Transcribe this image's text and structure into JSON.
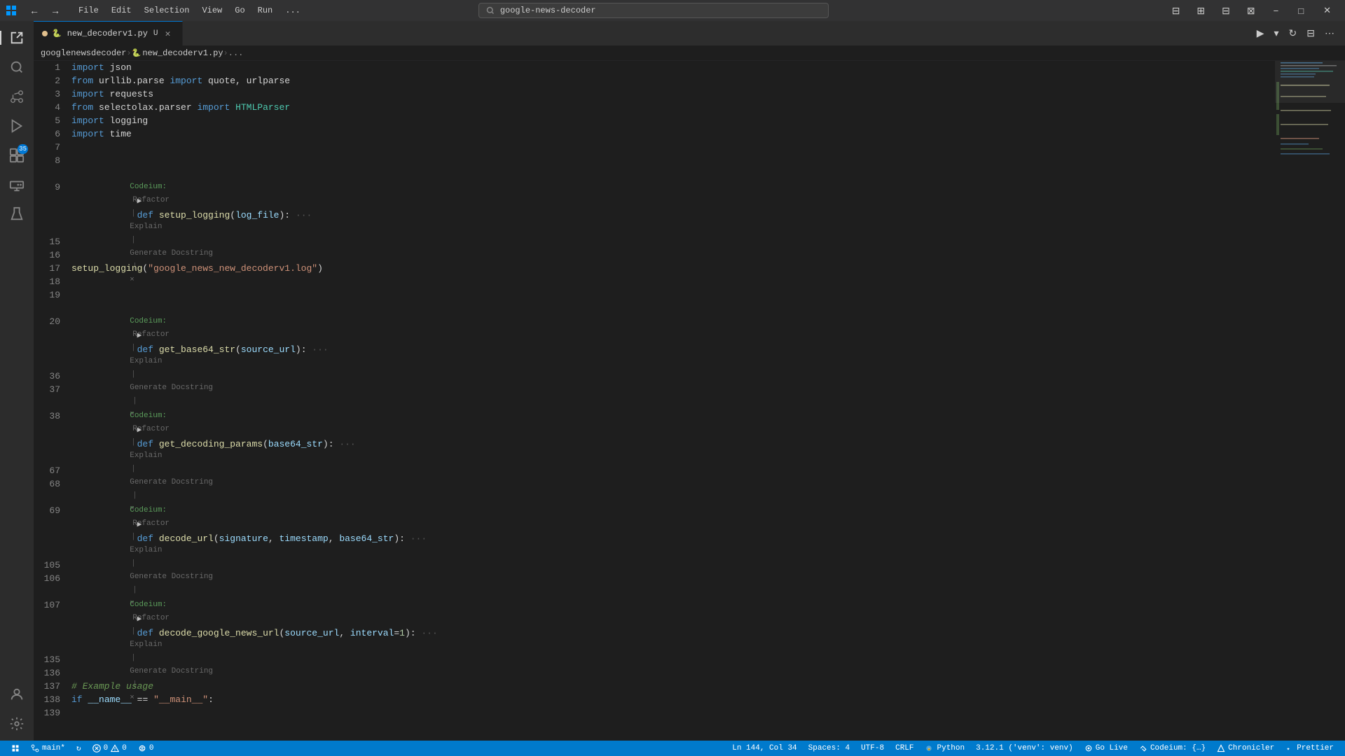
{
  "titlebar": {
    "icon": "⊞",
    "menus": [
      "File",
      "Edit",
      "Selection",
      "View",
      "Go",
      "Run",
      "..."
    ],
    "search_placeholder": "google-news-decoder",
    "nav_back": "←",
    "nav_forward": "→",
    "controls": [
      "⧉",
      "−",
      "□",
      "✕"
    ]
  },
  "activity_bar": {
    "items": [
      {
        "name": "explorer",
        "icon": "⬜",
        "label": "Explorer"
      },
      {
        "name": "search",
        "icon": "🔍",
        "label": "Search"
      },
      {
        "name": "source-control",
        "icon": "⑂",
        "label": "Source Control"
      },
      {
        "name": "run-debug",
        "icon": "▷",
        "label": "Run and Debug"
      },
      {
        "name": "extensions",
        "icon": "⊞",
        "label": "Extensions",
        "badge": "35"
      },
      {
        "name": "remote-explorer",
        "icon": "◫",
        "label": "Remote Explorer"
      },
      {
        "name": "testing",
        "icon": "⚗",
        "label": "Testing"
      }
    ],
    "bottom_items": [
      {
        "name": "account",
        "icon": "👤",
        "label": "Account"
      },
      {
        "name": "settings",
        "icon": "⚙",
        "label": "Settings"
      }
    ]
  },
  "tabs": [
    {
      "name": "new_decoderv1.py",
      "dirty": true,
      "active": true
    }
  ],
  "breadcrumb": {
    "parts": [
      "googlenewsdecoder",
      "new_decoderv1.py",
      "..."
    ]
  },
  "editor": {
    "lines": [
      {
        "ln": "1",
        "type": "code",
        "content": "import json"
      },
      {
        "ln": "2",
        "type": "code",
        "content": "from urllib.parse import quote, urlparse"
      },
      {
        "ln": "3",
        "type": "code",
        "content": "import requests"
      },
      {
        "ln": "4",
        "type": "code",
        "content": "from selectolax.parser import HTMLParser"
      },
      {
        "ln": "5",
        "type": "code",
        "content": "import logging"
      },
      {
        "ln": "6",
        "type": "code",
        "content": "import time"
      },
      {
        "ln": "7",
        "type": "blank"
      },
      {
        "ln": "8",
        "type": "blank"
      },
      {
        "ln": "9",
        "type": "codeium_lens",
        "lens": "Codeium: Refactor | Explain | Generate Docstring | ×"
      },
      {
        "ln": "9",
        "type": "fold",
        "content": "def setup_logging(log_file): ···"
      },
      {
        "ln": "15",
        "type": "blank"
      },
      {
        "ln": "16",
        "type": "blank"
      },
      {
        "ln": "17",
        "type": "code",
        "content": "setup_logging(\"google_news_new_decoderv1.log\")"
      },
      {
        "ln": "18",
        "type": "blank"
      },
      {
        "ln": "19",
        "type": "blank"
      },
      {
        "ln": "20",
        "type": "codeium_lens",
        "lens": "Codeium: Refactor | Explain | Generate Docstring | ×"
      },
      {
        "ln": "20",
        "type": "fold",
        "content": "def get_base64_str(source_url): ···"
      },
      {
        "ln": "36",
        "type": "blank"
      },
      {
        "ln": "37",
        "type": "blank"
      },
      {
        "ln": "38",
        "type": "codeium_lens",
        "lens": "Codeium: Refactor | Explain | Generate Docstring | ×"
      },
      {
        "ln": "38",
        "type": "fold",
        "content": "def get_decoding_params(base64_str): ···"
      },
      {
        "ln": "67",
        "type": "blank"
      },
      {
        "ln": "68",
        "type": "blank"
      },
      {
        "ln": "69",
        "type": "codeium_lens",
        "lens": "Codeium: Refactor | Explain | Generate Docstring | ×"
      },
      {
        "ln": "69",
        "type": "fold",
        "content": "def decode_url(signature, timestamp, base64_str): ···"
      },
      {
        "ln": "105",
        "type": "blank"
      },
      {
        "ln": "106",
        "type": "blank"
      },
      {
        "ln": "107",
        "type": "codeium_lens",
        "lens": "Codeium: Refactor | Explain | Generate Docstring | ×"
      },
      {
        "ln": "107",
        "type": "fold",
        "content": "def decode_google_news_url(source_url, interval=1): ···"
      },
      {
        "ln": "135",
        "type": "blank"
      },
      {
        "ln": "136",
        "type": "blank"
      },
      {
        "ln": "137",
        "type": "comment",
        "content": "# Example usage"
      },
      {
        "ln": "138",
        "type": "code",
        "content": "if __name__ == \"__main__\":"
      },
      {
        "ln": "139",
        "type": "blank"
      }
    ]
  },
  "toolbar_buttons": {
    "run": "▶",
    "run_dropdown": "▾",
    "restart": "↻",
    "settings2": "⋯",
    "layout": "⊟"
  },
  "status_bar": {
    "git_branch": "main*",
    "sync": "↻",
    "errors": "⊘ 0",
    "warnings": "⚠ 0",
    "remote": "⊞ 0",
    "position": "Ln 144, Col 34",
    "spaces": "Spaces: 4",
    "encoding": "UTF-8",
    "line_ending": "CRLF",
    "language": "Python",
    "python_version": "3.12.1 ('venv': venv)",
    "go_live": "Go Live",
    "codeium": "Codeium: {…}",
    "chronicler": "Chronicler",
    "prettier": "Prettier"
  }
}
